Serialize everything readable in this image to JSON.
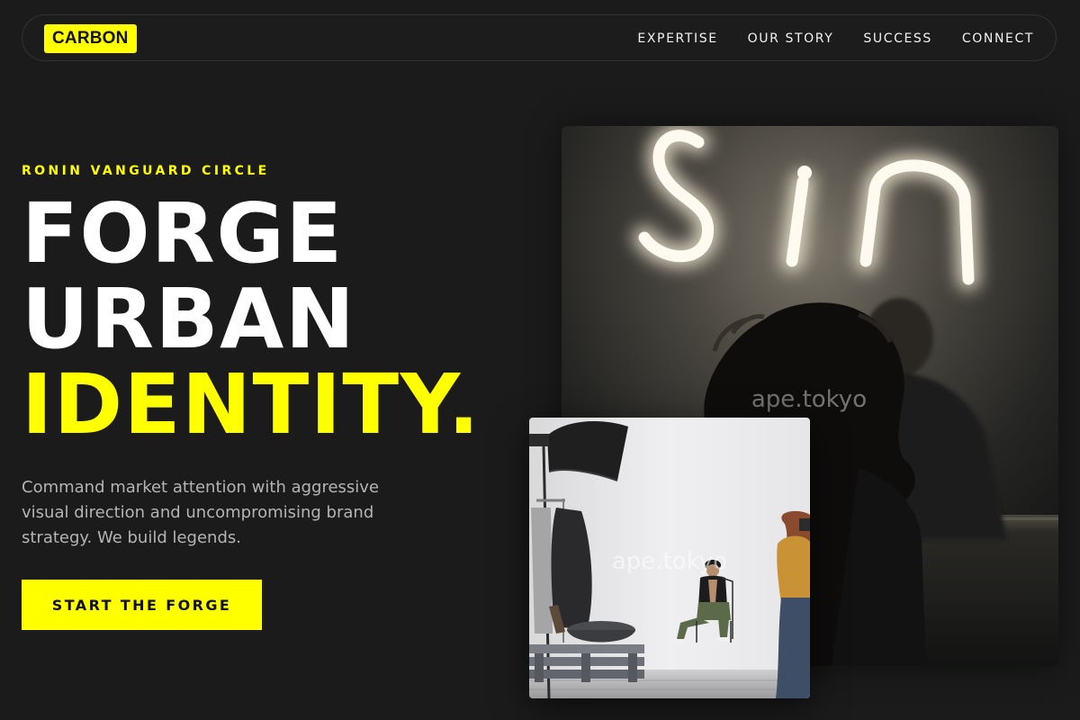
{
  "brand": {
    "logo_text": "CARBON",
    "accent_color": "#ffff00",
    "background_color": "#1b1b1b"
  },
  "nav": {
    "links": [
      {
        "label": "EXPERTISE"
      },
      {
        "label": "OUR STORY"
      },
      {
        "label": "SUCCESS"
      },
      {
        "label": "CONNECT"
      }
    ]
  },
  "hero": {
    "eyebrow": "RONIN VANGUARD CIRCLE",
    "headline": {
      "line1": "FORGE",
      "line2": "URBAN",
      "line3": "IDENTITY."
    },
    "description": "Command market attention with aggressive visual direction and uncompromising brand strategy. We build legends.",
    "cta_label": "START THE FORGE"
  },
  "images": {
    "neon_photo": {
      "sign_text": "Sin",
      "watermark": "ape.tokyo"
    },
    "studio_photo": {
      "watermark": "ape.tokyo"
    }
  }
}
